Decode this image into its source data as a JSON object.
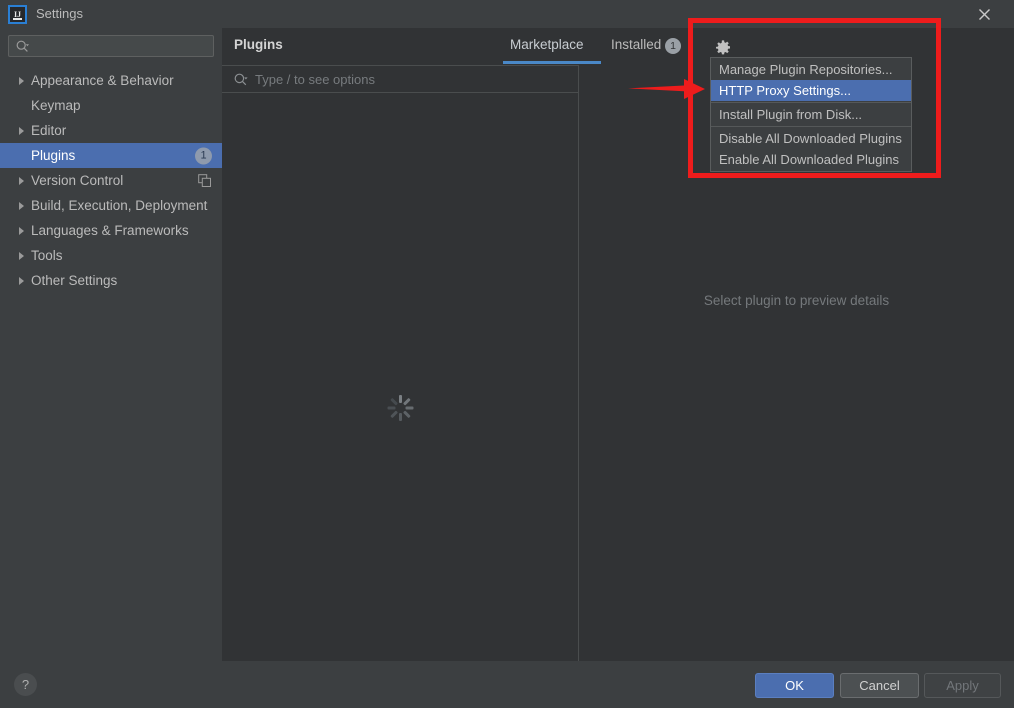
{
  "window": {
    "title": "Settings",
    "logo_text": "IJ",
    "close_icon": "close-icon"
  },
  "sidebar": {
    "search": {
      "placeholder": "",
      "value": "",
      "icon": "search-icon"
    },
    "items": [
      {
        "label": "Appearance & Behavior",
        "expandable": true,
        "selected": false,
        "badge": "",
        "icon": ""
      },
      {
        "label": "Keymap",
        "expandable": false,
        "selected": false,
        "badge": "",
        "icon": ""
      },
      {
        "label": "Editor",
        "expandable": true,
        "selected": false,
        "badge": "",
        "icon": ""
      },
      {
        "label": "Plugins",
        "expandable": false,
        "selected": true,
        "badge": "1",
        "icon": ""
      },
      {
        "label": "Version Control",
        "expandable": true,
        "selected": false,
        "badge": "",
        "icon": "copy-icon"
      },
      {
        "label": "Build, Execution, Deployment",
        "expandable": true,
        "selected": false,
        "badge": "",
        "icon": ""
      },
      {
        "label": "Languages & Frameworks",
        "expandable": true,
        "selected": false,
        "badge": "",
        "icon": ""
      },
      {
        "label": "Tools",
        "expandable": true,
        "selected": false,
        "badge": "",
        "icon": ""
      },
      {
        "label": "Other Settings",
        "expandable": true,
        "selected": false,
        "badge": "",
        "icon": ""
      }
    ]
  },
  "main": {
    "page_title": "Plugins",
    "tabs": [
      {
        "label": "Marketplace",
        "active": true,
        "badge": ""
      },
      {
        "label": "Installed",
        "active": false,
        "badge": "1"
      }
    ],
    "gear_icon": "gear-icon",
    "plugin_search": {
      "placeholder": "Type / to see options",
      "value": "",
      "icon": "search-icon"
    },
    "list_status": "loading",
    "preview_placeholder": "Select plugin to preview details"
  },
  "popup_menu": {
    "items": [
      {
        "label": "Manage Plugin Repositories...",
        "highlighted": false,
        "separator_after": false
      },
      {
        "label": "HTTP Proxy Settings...",
        "highlighted": true,
        "separator_after": true
      },
      {
        "label": "Install Plugin from Disk...",
        "highlighted": false,
        "separator_after": true
      },
      {
        "label": "Disable All Downloaded Plugins",
        "highlighted": false,
        "separator_after": false
      },
      {
        "label": "Enable All Downloaded Plugins",
        "highlighted": false,
        "separator_after": false
      }
    ]
  },
  "footer": {
    "help_label": "?",
    "ok_label": "OK",
    "cancel_label": "Cancel",
    "apply_label": "Apply"
  },
  "annotations": {
    "highlight_color": "#ee1c1c",
    "box_target": "plugin-settings-menu",
    "arrow_target": "http-proxy-settings-menu-item"
  },
  "colors": {
    "selection_blue": "#4b6eaf",
    "tab_underline": "#4a88c7",
    "sidebar_bg": "#3c3f41",
    "content_bg": "#313335"
  }
}
